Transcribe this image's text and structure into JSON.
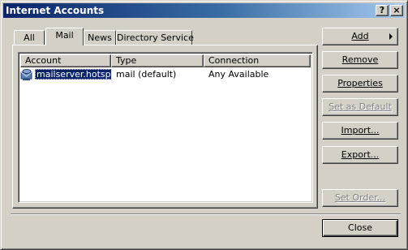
{
  "window": {
    "title": "Internet Accounts",
    "help_glyph": "?",
    "close_glyph": "×"
  },
  "tabs": [
    {
      "label": "All",
      "active": false
    },
    {
      "label": "Mail",
      "active": true
    },
    {
      "label": "News",
      "active": false
    },
    {
      "label": "Directory Service",
      "active": false
    }
  ],
  "list": {
    "columns": [
      "Account",
      "Type",
      "Connection"
    ],
    "rows": [
      {
        "account": "mailserver.hotspa...",
        "type": "mail (default)",
        "connection": "Any Available",
        "icon": "mail-account-icon",
        "selected": true
      }
    ]
  },
  "buttons": {
    "add": "Add",
    "remove": "Remove",
    "properties": "Properties",
    "set_as_default": "Set as Default",
    "import": "Import...",
    "export": "Export...",
    "set_order": "Set Order...",
    "close": "Close"
  },
  "colors": {
    "title_start": "#0a246a",
    "title_end": "#a6caf0",
    "face": "#d4d0c8",
    "selection": "#0a246a"
  }
}
